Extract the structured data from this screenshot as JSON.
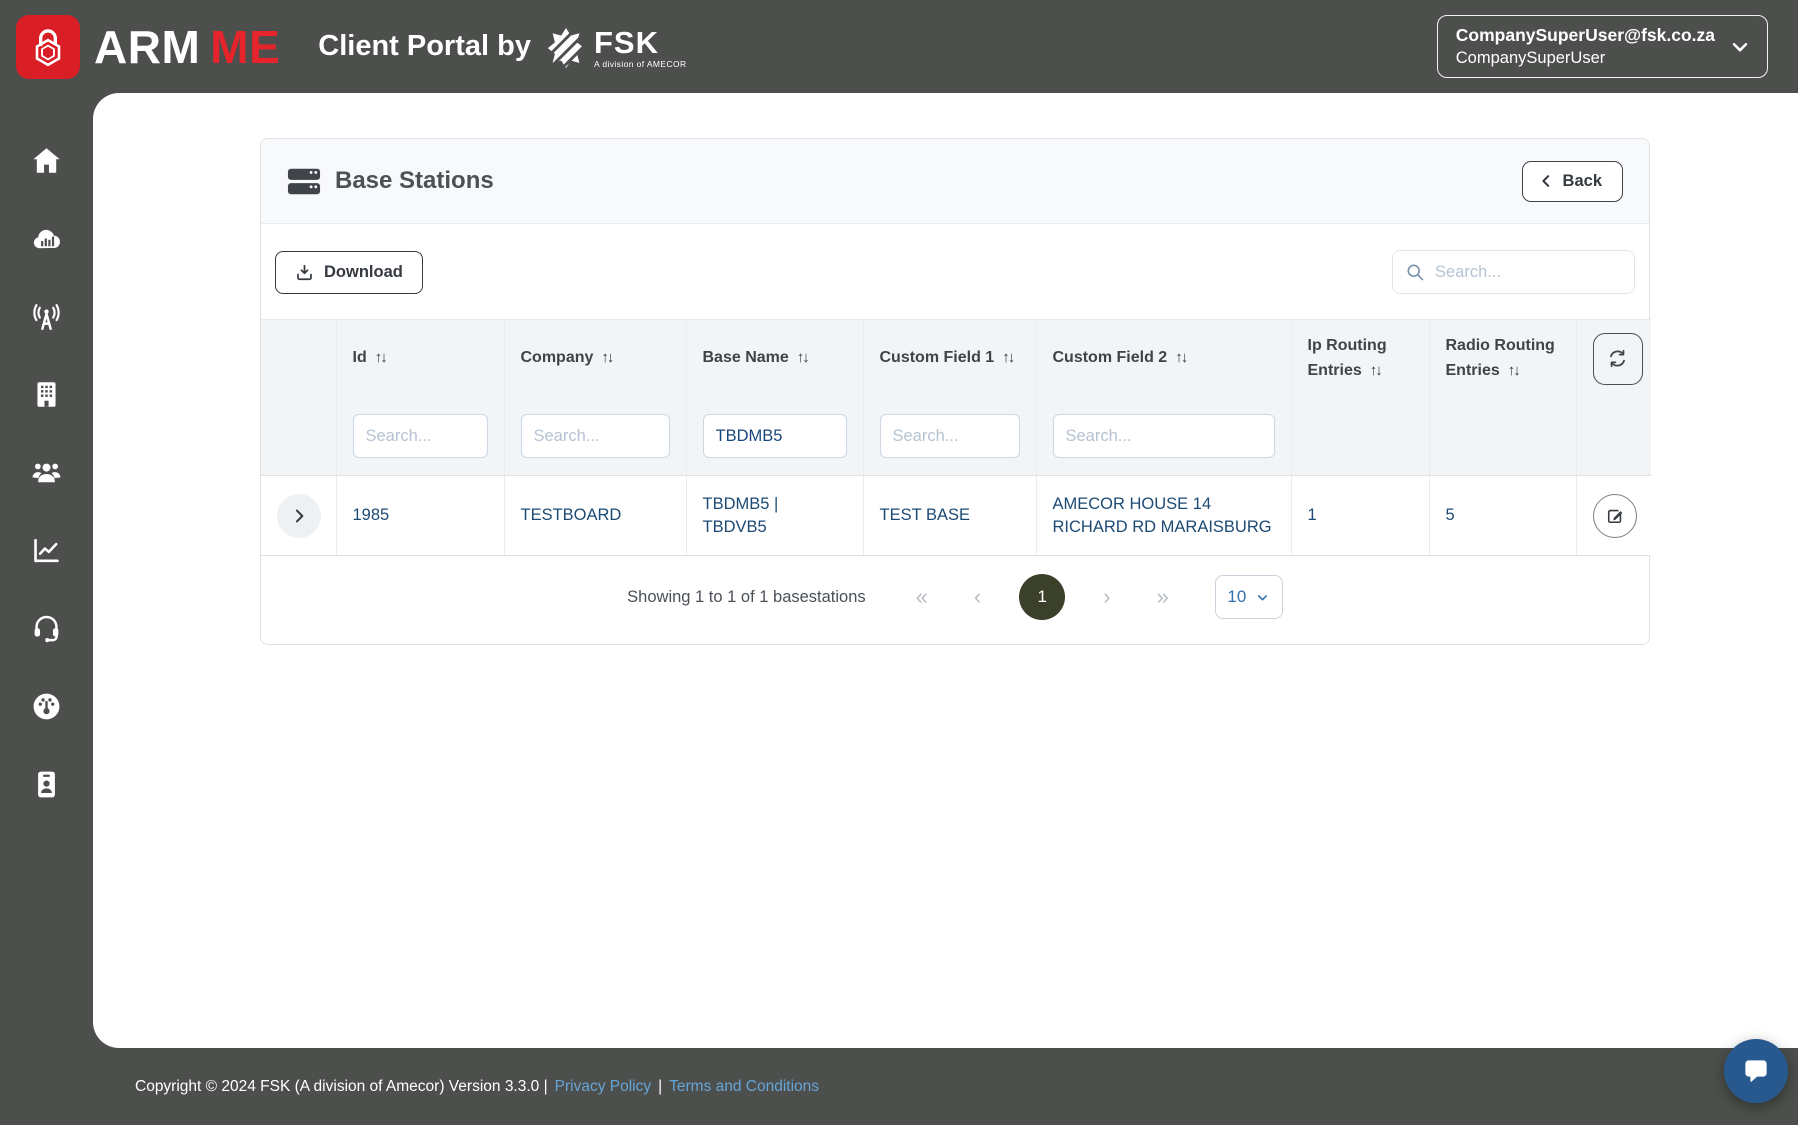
{
  "header": {
    "brand_arm": "ARM",
    "brand_me": "ME",
    "portal_title": "Client Portal by",
    "fsk_logo_text": "FSK",
    "fsk_tagline": "A division of AMECOR",
    "user_email": "CompanySuperUser@fsk.co.za",
    "user_name": "CompanySuperUser"
  },
  "sidebar": {
    "items": [
      {
        "icon": "home-icon"
      },
      {
        "icon": "cloud-chart-icon"
      },
      {
        "icon": "broadcast-tower-icon"
      },
      {
        "icon": "building-icon"
      },
      {
        "icon": "users-icon"
      },
      {
        "icon": "chart-line-icon"
      },
      {
        "icon": "headset-icon"
      },
      {
        "icon": "gauge-icon"
      },
      {
        "icon": "id-badge-icon"
      }
    ]
  },
  "page": {
    "title": "Base Stations",
    "back_label": "Back",
    "download_label": "Download",
    "search_placeholder": "Search..."
  },
  "table": {
    "columns": [
      {
        "label": "Id"
      },
      {
        "label": "Company"
      },
      {
        "label": "Base Name"
      },
      {
        "label": "Custom Field 1"
      },
      {
        "label": "Custom Field 2"
      },
      {
        "label": "Ip Routing Entries"
      },
      {
        "label": "Radio Routing Entries"
      }
    ],
    "filters": {
      "id_placeholder": "Search...",
      "company_placeholder": "Search...",
      "base_name_value": "TBDMB5",
      "custom_field_1_placeholder": "Search...",
      "custom_field_2_placeholder": "Search..."
    },
    "rows": [
      {
        "id": "1985",
        "company": "TESTBOARD",
        "base_name": "TBDMB5 | TBDVB5",
        "custom_field_1": "TEST BASE",
        "custom_field_2": "AMECOR HOUSE 14 RICHARD RD MARAISBURG",
        "ip_routing_entries": "1",
        "radio_routing_entries": "5"
      }
    ]
  },
  "pagination": {
    "summary": "Showing 1 to 1 of 1 basestations",
    "current_page": "1",
    "page_size": "10"
  },
  "footer": {
    "copyright": "Copyright © 2024 FSK (A division of Amecor) Version 3.3.0 |",
    "separator": "|",
    "privacy_label": "Privacy Policy",
    "terms_label": "Terms and Conditions"
  },
  "icons": {
    "sort": "↑↓",
    "first": "«",
    "prev": "‹",
    "next": "›",
    "last": "»"
  },
  "colors": {
    "frame_dark": "#4c4f4c",
    "brand_red": "#d91e26",
    "data_navy": "#1c4a74",
    "link_blue": "#66a5d8",
    "active_page": "#3a4029",
    "chat_blue": "#27598e"
  }
}
